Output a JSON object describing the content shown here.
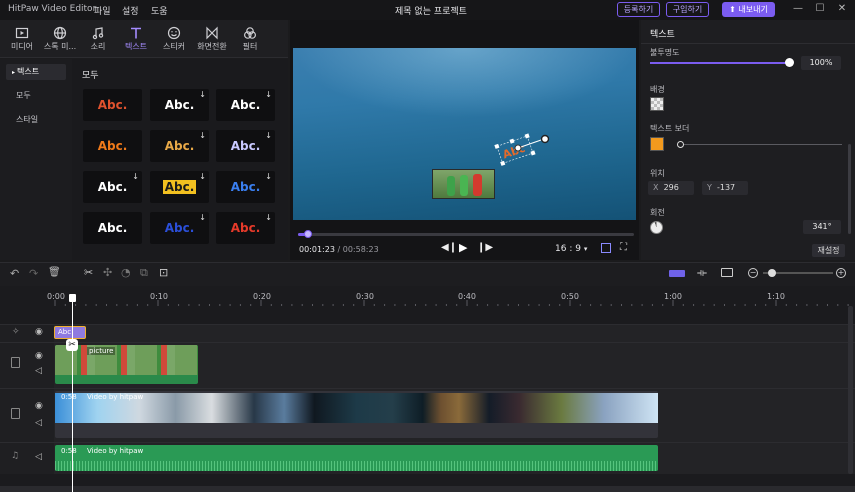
{
  "app": {
    "title": "HitPaw Video Editor",
    "menu": [
      "파일",
      "설정",
      "도움"
    ],
    "project_title": "제목 없는 프로젝트",
    "register_label": "등록하기",
    "buy_label": "구입하기",
    "export_label": "내보내기"
  },
  "media_tabs": [
    {
      "label": "미디어",
      "icon": "media-icon"
    },
    {
      "label": "스톡 미...",
      "icon": "globe-icon"
    },
    {
      "label": "소리",
      "icon": "music-icon"
    },
    {
      "label": "텍스트",
      "icon": "text-icon",
      "active": true
    },
    {
      "label": "스티커",
      "icon": "sticker-icon"
    },
    {
      "label": "화면전환",
      "icon": "transition-icon"
    },
    {
      "label": "필터",
      "icon": "filter-icon"
    }
  ],
  "left_nav": {
    "section": "텍스트",
    "items": [
      "모두",
      "스타일"
    ]
  },
  "text_panel": {
    "heading": "모두",
    "tiles": [
      {
        "label": "Abc.",
        "color": "#e0522e"
      },
      {
        "label": "Abc.",
        "color": "#ffffff"
      },
      {
        "label": "Abc.",
        "color": "#ffffff"
      },
      {
        "label": "Abc.",
        "color": "#f07a1a"
      },
      {
        "label": "Abc.",
        "color": "#e8a948"
      },
      {
        "label": "Abc.",
        "color": "#c9c9ff"
      },
      {
        "label": "Abc.",
        "color": "#ffffff"
      },
      {
        "label": "Abc.",
        "color": "#1a1a1a"
      },
      {
        "label": "Abc.",
        "color": "#3a7ff0"
      },
      {
        "label": "Abc.",
        "color": "#ffffff"
      },
      {
        "label": "Abc.",
        "color": "#2b4fd9"
      },
      {
        "label": "Abc.",
        "color": "#e63a2a"
      }
    ]
  },
  "player": {
    "current_time": "00:01:23",
    "separator": "/",
    "total_time": "00:58:23",
    "aspect_ratio": "16 : 9",
    "progress": 0.03
  },
  "properties": {
    "header": "텍스트",
    "opacity_label": "불투명도",
    "opacity_value": "100%",
    "background_label": "배경",
    "border_label": "텍스트 보더",
    "border_color": "#f39a1e",
    "position_label": "위치",
    "x_label": "X",
    "x_value": "296",
    "y_label": "Y",
    "y_value": "-137",
    "rotation_label": "회전",
    "rotation_value": "341°",
    "reset_label": "재설정"
  },
  "timeline": {
    "ruler": [
      "0:00",
      "0:10",
      "0:20",
      "0:30",
      "0:40",
      "0:50",
      "1:00",
      "1:10"
    ],
    "clips": {
      "text_clip": "Abc",
      "picture_clip": "picture",
      "video_duration": "0:58",
      "video_label": "Video by hitpaw",
      "audio_duration": "0:58",
      "audio_label": "Video by hitpaw"
    }
  }
}
